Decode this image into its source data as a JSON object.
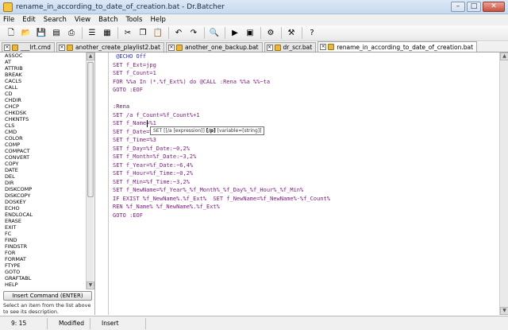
{
  "window": {
    "title": "rename_in_according_to_date_of_creation.bat - Dr.Batcher",
    "controls": {
      "minimize": "–",
      "maximize": "□",
      "close": "✕"
    }
  },
  "menu": [
    "File",
    "Edit",
    "Search",
    "View",
    "Batch",
    "Tools",
    "Help"
  ],
  "toolbar": [
    {
      "name": "new-file-icon",
      "glyph": "🗋"
    },
    {
      "name": "open-folder-icon",
      "glyph": "📂"
    },
    {
      "name": "save-icon",
      "glyph": "💾"
    },
    {
      "name": "save-all-icon",
      "glyph": "▤"
    },
    {
      "name": "print-icon",
      "glyph": "⎙"
    },
    {
      "sep": true
    },
    {
      "name": "view-list-icon",
      "glyph": "☰"
    },
    {
      "name": "view-details-icon",
      "glyph": "▦"
    },
    {
      "sep": true
    },
    {
      "name": "cut-icon",
      "glyph": "✂"
    },
    {
      "name": "copy-icon",
      "glyph": "❐"
    },
    {
      "name": "paste-icon",
      "glyph": "📋"
    },
    {
      "sep": true
    },
    {
      "name": "undo-icon",
      "glyph": "↶"
    },
    {
      "name": "redo-icon",
      "glyph": "↷"
    },
    {
      "sep": true
    },
    {
      "name": "find-icon",
      "glyph": "🔍"
    },
    {
      "sep": true
    },
    {
      "name": "run-icon",
      "glyph": "▶"
    },
    {
      "name": "run-console-icon",
      "glyph": "▣"
    },
    {
      "sep": true
    },
    {
      "name": "make-exe-icon",
      "glyph": "⚙"
    },
    {
      "sep": true
    },
    {
      "name": "tools-dropdown-icon",
      "glyph": "⚒"
    },
    {
      "sep": true
    },
    {
      "name": "help-icon",
      "glyph": "?"
    }
  ],
  "tabs": [
    {
      "label": "___lrt.cmd",
      "active": false
    },
    {
      "label": "another_create_playlist2.bat",
      "active": false
    },
    {
      "label": "another_one_backup.bat",
      "active": false
    },
    {
      "label": "dr_scr.bat",
      "active": false
    },
    {
      "label": "rename_in_according_to_date_of_creation.bat",
      "active": true
    }
  ],
  "commands": [
    "ASSOC",
    "AT",
    "ATTRIB",
    "BREAK",
    "CACLS",
    "CALL",
    "CD",
    "CHDIR",
    "CHCP",
    "CHKDSK",
    "CHKNTFS",
    "CLS",
    "CMD",
    "COLOR",
    "COMP",
    "COMPACT",
    "CONVERT",
    "COPY",
    "DATE",
    "DEL",
    "DIR",
    "DISKCOMP",
    "DISKCOPY",
    "DOSKEY",
    "ECHO",
    "ENDLOCAL",
    "ERASE",
    "EXIT",
    "FC",
    "FIND",
    "FINDSTR",
    "FOR",
    "FORMAT",
    "FTYPE",
    "GOTO",
    "GRAFTABL",
    "HELP"
  ],
  "insert_button": "Insert Command (ENTER)",
  "description": "Select an item from the list above to see its description.",
  "code": [
    {
      "text": " @ECHO Off",
      "style": "blue"
    },
    {
      "text": "SET f_Ext=jpg",
      "style": "purple"
    },
    {
      "text": "SET f_Count=1",
      "style": "purple"
    },
    {
      "text": "FOR %%a In (*.%f_Ext%) do @CALL :Rena %%a %%~ta",
      "style": "purple"
    },
    {
      "text": "GOTO :EOF",
      "style": "purple"
    },
    {
      "text": "",
      "style": "purple"
    },
    {
      "text": ":Rena",
      "style": "dark"
    },
    {
      "text": "SET /a f_Count=%f_Count%+1",
      "style": "purple"
    },
    {
      "text": "SET f_Name=%1",
      "style": "purple"
    },
    {
      "text": "SET f_Date=%2",
      "style": "purple"
    },
    {
      "text": "SET f_Time=%3",
      "style": "purple"
    },
    {
      "text": "SET f_Day=%f_Date:~0,2%",
      "style": "purple"
    },
    {
      "text": "SET f_Month=%f_Date:~3,2%",
      "style": "purple"
    },
    {
      "text": "SET f_Year=%f_Date:~6,4%",
      "style": "purple"
    },
    {
      "text": "SET f_Hour=%f_Time:~0,2%",
      "style": "purple"
    },
    {
      "text": "SET f_Min=%f_Time:~3,2%",
      "style": "purple"
    },
    {
      "text": "SET f_NewName=%f_Year%_%f_Month%_%f_Day%_%f_Hour%_%f_Min%",
      "style": "purple"
    },
    {
      "text": "IF EXIST %f_NewName%.%f_Ext%  SET f_NewName=%f_NewName%-%f_Count%",
      "style": "purple"
    },
    {
      "text": "REN %f_Name% %f_NewName%.%f_Ext%",
      "style": "purple"
    },
    {
      "text": "GOTO :EOF",
      "style": "purple"
    }
  ],
  "tooltip": {
    "prefix": "SET [[/a [expression]] ",
    "bold": "[/p]",
    "suffix": " [variable=[string]]"
  },
  "status": {
    "position": "9: 15",
    "modified": "Modified",
    "mode": "Insert"
  },
  "colors": {
    "code_purple": "#7a1b7a",
    "code_blue": "#2a2fb5",
    "label_dark": "#502050"
  }
}
